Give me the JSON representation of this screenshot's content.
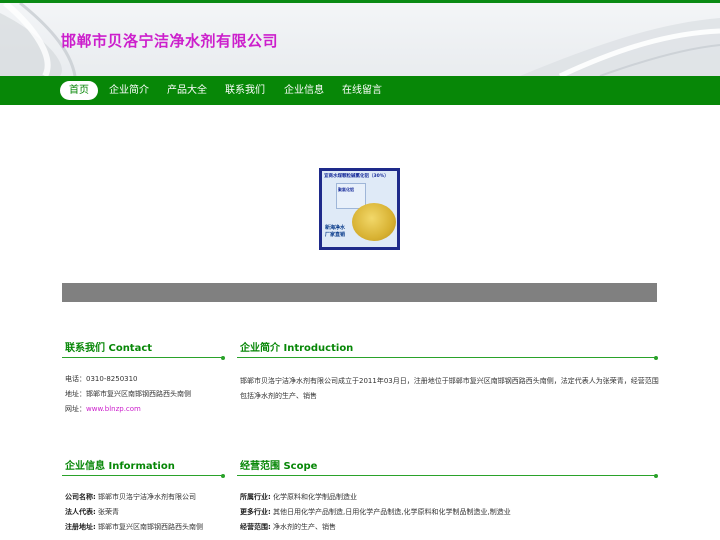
{
  "site": {
    "title": "邯郸市贝洛宁洁净水剂有限公司"
  },
  "nav": {
    "items": [
      "首页",
      "企业简介",
      "产品大全",
      "联系我们",
      "企业信息",
      "在线留言"
    ],
    "active": 0
  },
  "product": {
    "banner_text": "宜商水煤颗粒碱氯化铝（30%）",
    "bag_text": "聚氯化铝",
    "label_line1": "新海净水",
    "label_line2": "厂家直销"
  },
  "contact": {
    "title": "联系我们 Contact",
    "phone_label": "电话：",
    "phone": "0310-8250310",
    "address_label": "地址：",
    "address": "邯郸市复兴区南邯钢西路西头南侧",
    "website_label": "网址：",
    "website": "www.blnzp.com"
  },
  "intro": {
    "title": "企业简介 Introduction",
    "text": "邯郸市贝洛宁洁净水剂有限公司成立于2011年03月日，注册地位于邯郸市复兴区南邯钢西路西头南侧，法定代表人为张荣青，经营范围包括净水剂的生产、销售"
  },
  "info": {
    "title": "企业信息 Information",
    "rows": [
      {
        "label": "公司名称:",
        "value": "邯郸市贝洛宁洁净水剂有限公司"
      },
      {
        "label": "法人代表:",
        "value": "张荣青"
      },
      {
        "label": "注册地址:",
        "value": "邯郸市复兴区南邯钢西路西头南侧"
      }
    ]
  },
  "scope": {
    "title": "经营范围 Scope",
    "rows": [
      {
        "label": "所属行业:",
        "value": "化学原料和化学制品制造业"
      },
      {
        "label": "更多行业:",
        "value": "其他日用化学产品制造,日用化学产品制造,化学原料和化学制品制造业,制造业"
      },
      {
        "label": "经营范围:",
        "value": "净水剂的生产、销售"
      }
    ]
  },
  "colors": {
    "brand_green": "#078707",
    "title_magenta": "#cc1fcc",
    "banner_gray": "#808080"
  }
}
